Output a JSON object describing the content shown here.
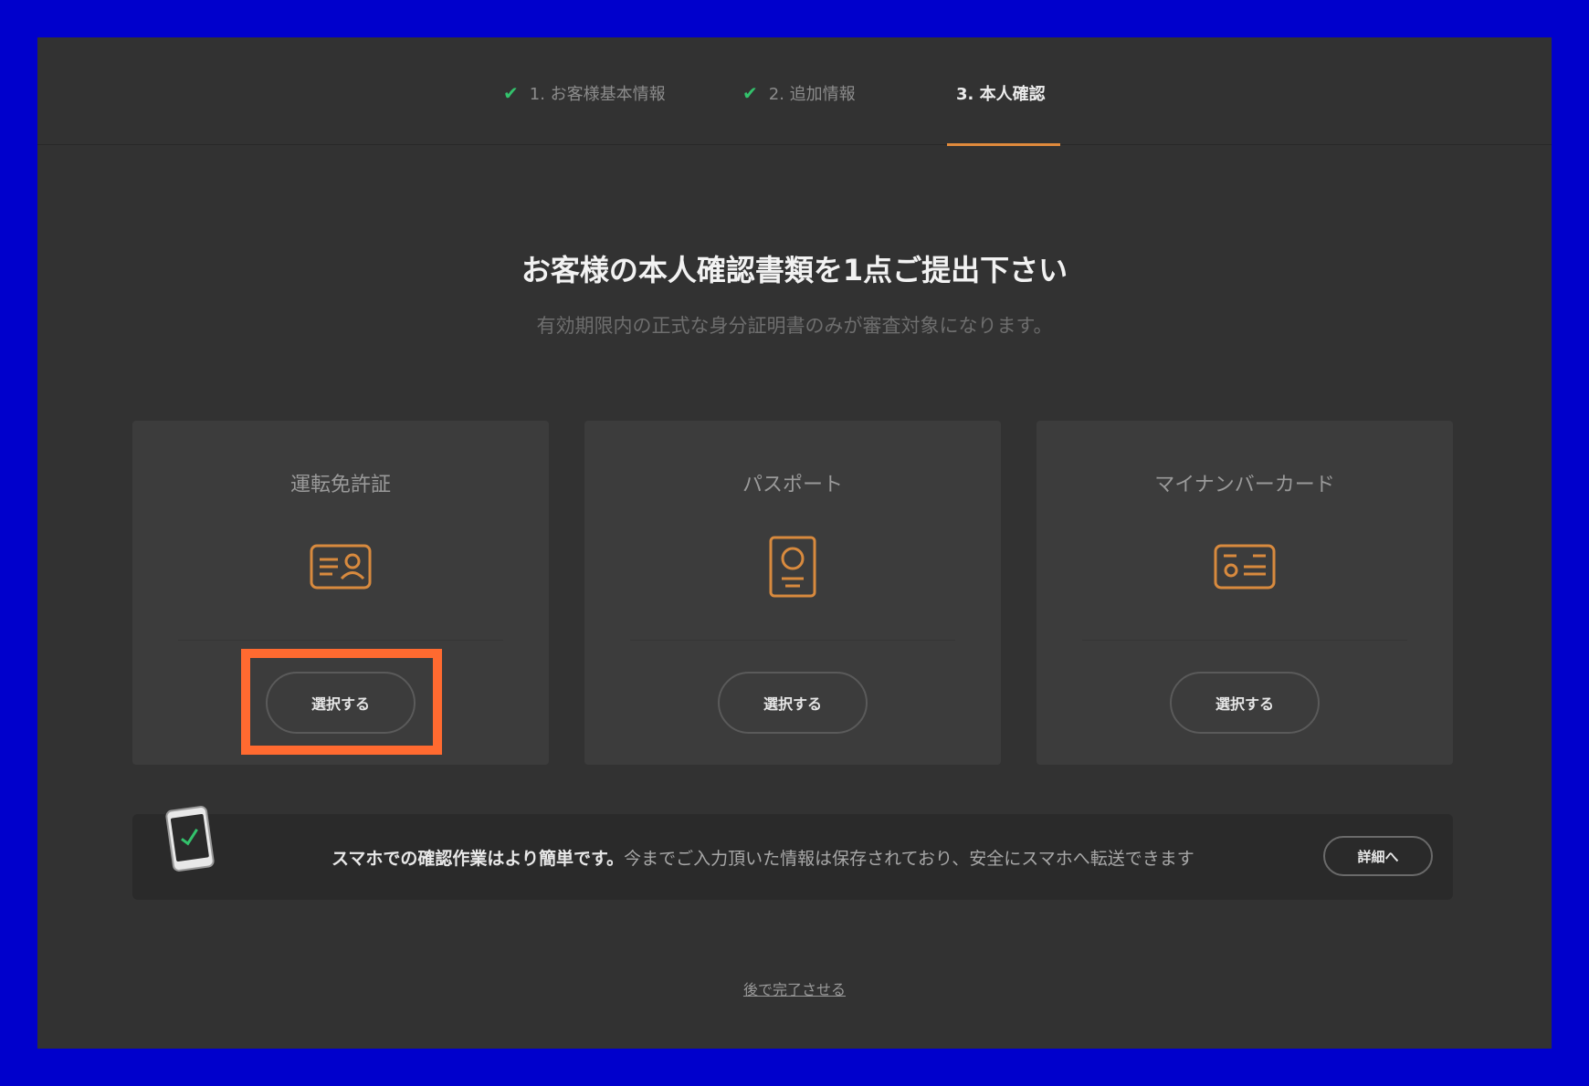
{
  "steps": [
    {
      "label": "1. お客様基本情報",
      "check": "✔"
    },
    {
      "label": "2. 追加情報",
      "check": "✔"
    },
    {
      "label": "3. 本人確認"
    }
  ],
  "heading": {
    "title": "お客様の本人確認書類を1点ご提出下さい",
    "subtitle": "有効期限内の正式な身分証明書のみが審査対象になります。"
  },
  "cards": [
    {
      "title": "運転免許証",
      "icon": "drivers-license-icon",
      "button": "選択する"
    },
    {
      "title": "パスポート",
      "icon": "passport-icon",
      "button": "選択する"
    },
    {
      "title": "マイナンバーカード",
      "icon": "my-number-card-icon",
      "button": "選択する"
    }
  ],
  "banner": {
    "icon": "smartphone-check-icon",
    "bold_text": "スマホでの確認作業はより簡単です。",
    "text": "今までご入力頂いた情報は保存されており、安全にスマホへ転送できます",
    "button": "詳細へ"
  },
  "later_link": "後で完了させる",
  "colors": {
    "accent": "#e08a3c",
    "check": "#33c26c",
    "highlight": "#ff6a30",
    "outer_border": "#0000cc"
  }
}
